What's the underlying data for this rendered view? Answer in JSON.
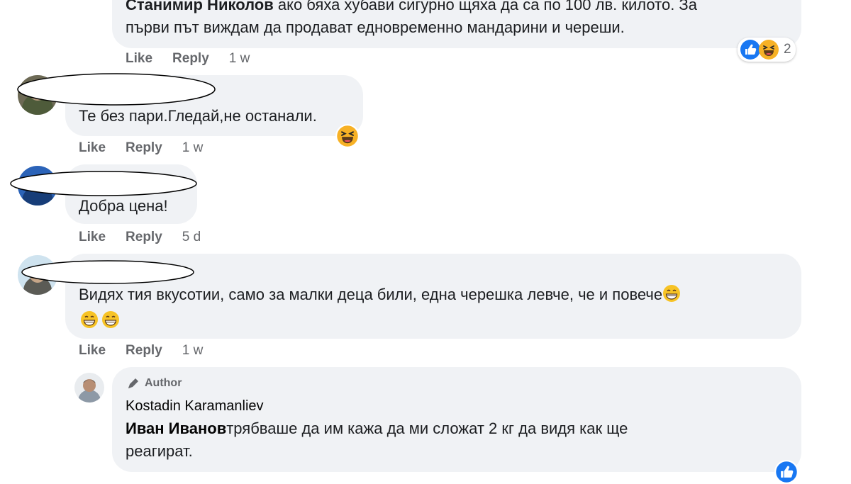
{
  "comments": [
    {
      "author": "Станимир Николов",
      "text_line1_rest": " ако бяха хубави сигурно щяха да са по 100 лв. килото. За",
      "text_line2": "първи път виждам да продават едновременно мандарини и череши.",
      "like": "Like",
      "reply": "Reply",
      "time": "1 w",
      "reaction_count": "2",
      "reaction_icons": [
        "like-icon",
        "haha-icon"
      ]
    },
    {
      "text": "Те без пари.Гледай,не останали.",
      "like": "Like",
      "reply": "Reply",
      "time": "1 w",
      "reaction_icons": [
        "haha-icon"
      ]
    },
    {
      "text": "Добра цена!",
      "like": "Like",
      "reply": "Reply",
      "time": "5 d"
    },
    {
      "text_line1": "Видях тия вкусотии, само за малки деца били, една черешка левче, че и повече",
      "like": "Like",
      "reply": "Reply",
      "time": "1 w",
      "emoji_icons": [
        "grin-icon",
        "grin-icon",
        "grin-icon"
      ]
    }
  ],
  "reply": {
    "author_tag": "Author",
    "author": "Kostadin Karamanliev",
    "mention": "Иван Иванов",
    "text_line1_rest": "трябваше да им кажа да ми сложат 2 кг да видя как ще",
    "text_line2": "реагират.",
    "reaction_icons": [
      "like-icon"
    ]
  },
  "colors": {
    "bubble": "#f0f2f5",
    "meta": "#65676b",
    "like_blue": "#1877f2",
    "emoji_yellow": "#f7b125"
  }
}
